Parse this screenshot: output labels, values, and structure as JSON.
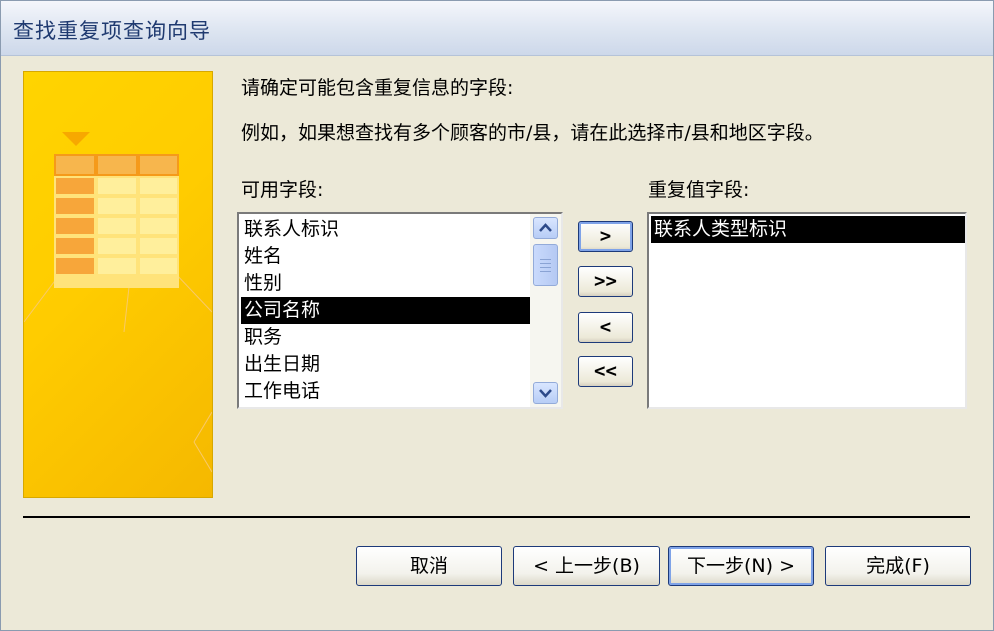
{
  "window": {
    "title": "查找重复项查询向导"
  },
  "instructions": {
    "line1": "请确定可能包含重复信息的字段:",
    "line2": "例如，如果想查找有多个顾客的市/县，请在此选择市/县和地区字段。"
  },
  "available": {
    "label": "可用字段:",
    "items": [
      "联系人标识",
      "姓名",
      "性别",
      "公司名称",
      "职务",
      "出生日期",
      "工作电话"
    ],
    "selected": "公司名称"
  },
  "duplicates": {
    "label": "重复值字段:",
    "items": [
      "联系人类型标识"
    ]
  },
  "move_buttons": {
    "add_one": ">",
    "add_all": ">>",
    "remove_one": "<",
    "remove_all": "<<"
  },
  "footer": {
    "cancel": "取消",
    "back": "< 上一步(B)",
    "next": "下一步(N) >",
    "finish": "完成(F)"
  },
  "icons": {
    "scroll_up": "chevron-up-icon",
    "scroll_down": "chevron-down-icon",
    "wizard_art": "table-wizard-illustration"
  }
}
